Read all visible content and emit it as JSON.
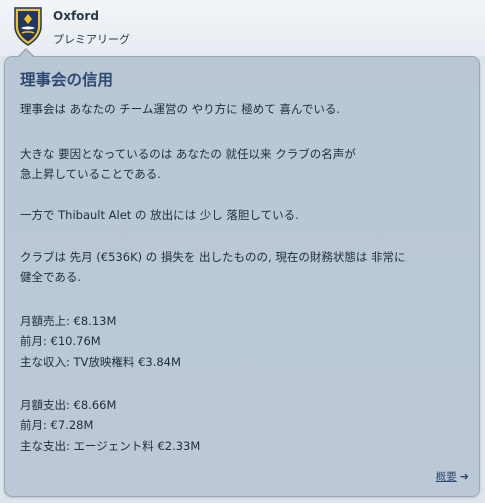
{
  "header": {
    "club_name": "Oxford",
    "league_name": "プレミアリーグ",
    "crest_icon": "club-crest-icon",
    "colors": {
      "crest_yellow": "#f2c519",
      "crest_navy": "#1f3566",
      "title_blue": "#2d4a72",
      "panel_bg": "#bac7d5"
    }
  },
  "panel": {
    "title": "理事会の信用",
    "lines": [
      "理事会は あなたの チーム運営の やり方に 極めて 喜んでいる.",
      "大きな 要因となっているのは あなたの 就任以来 クラブの名声が",
      "急上昇していることである.",
      "一方で Thibault Alet の 放出には 少し 落胆している.",
      "クラブは 先月 (€536K) の 損失を 出したものの, 現在の財務状態は 非常に",
      "健全である.",
      "月額売上: €8.13M",
      "前月: €10.76M",
      "主な収入: TV放映権料 €3.84M",
      "月額支出: €8.66M",
      "前月: €7.28M",
      "主な支出: エージェント料 €2.33M"
    ],
    "more_link": "概要",
    "more_link_icon": "arrow-right-icon"
  }
}
